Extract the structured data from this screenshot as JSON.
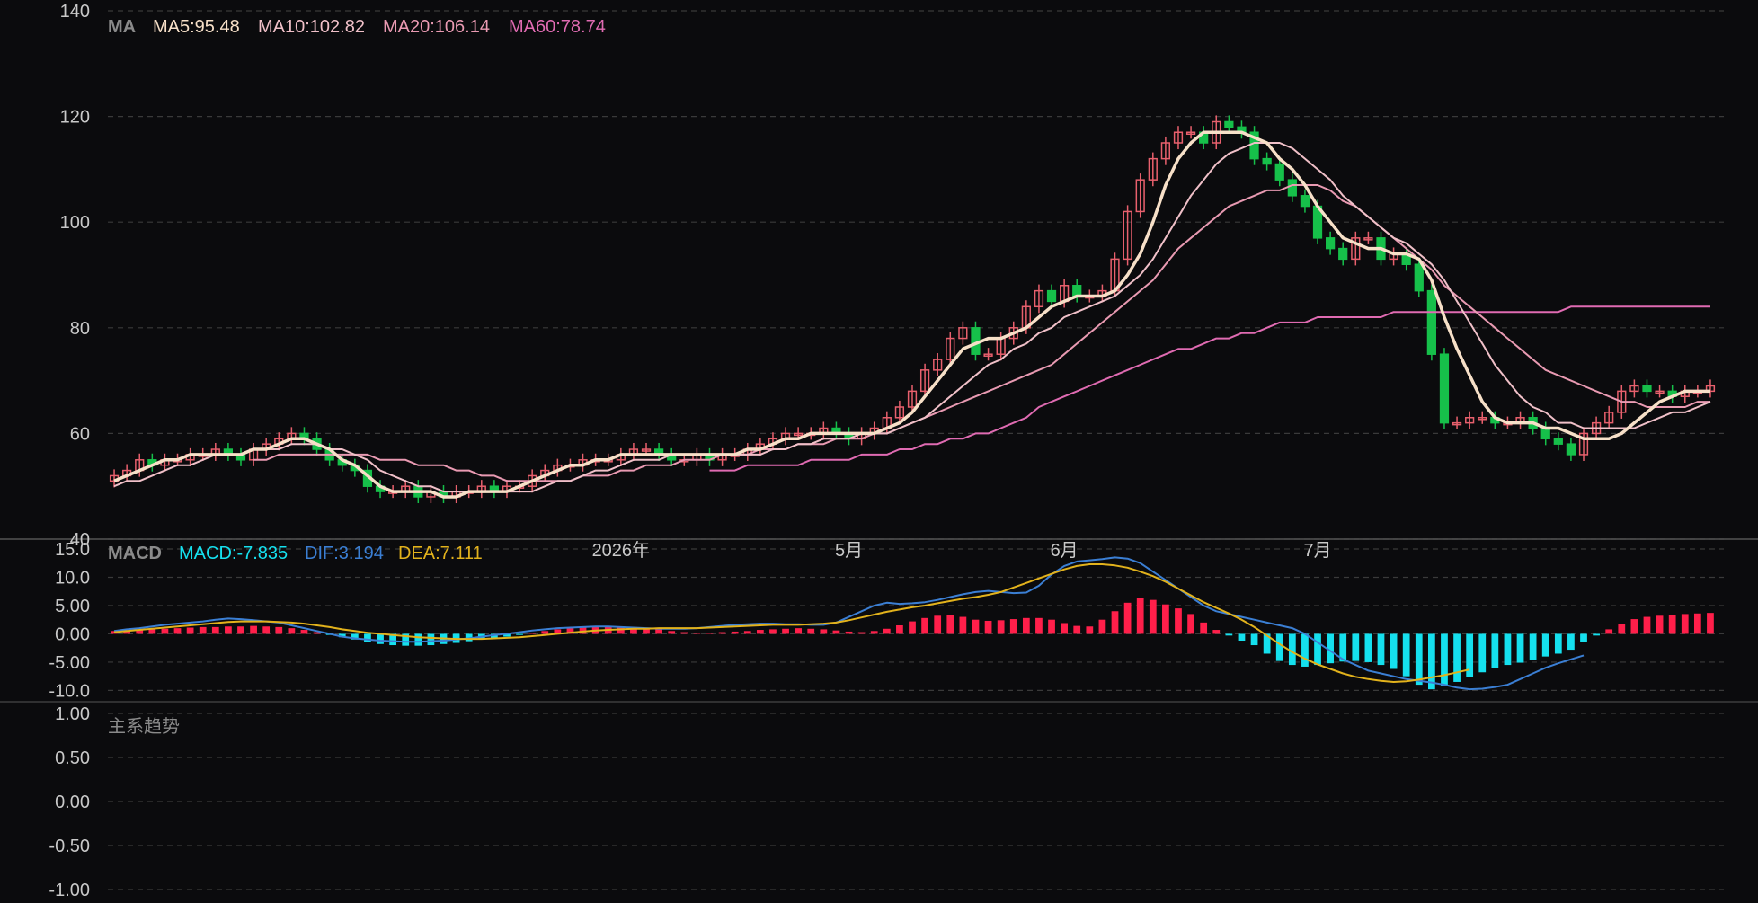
{
  "colors": {
    "background": "#0b0b0d",
    "grid": "#3a3a3a",
    "axis_text": "#c9c9c9",
    "up": "#ff3b50",
    "up_outline": "#e8606d",
    "down": "#16c04a",
    "ma5": "#f7e0c8",
    "ma10": "#f0c0c8",
    "ma20": "#e99ab2",
    "ma60": "#e06bb2",
    "macd_pos": "#ff1f4a",
    "macd_neg": "#15e0ee",
    "dif": "#3b7fd4",
    "dea": "#e2b21c"
  },
  "legends": {
    "main": {
      "title": "MA",
      "ma5": "MA5:95.48",
      "ma10": "MA10:102.82",
      "ma20": "MA20:106.14",
      "ma60": "MA60:78.74"
    },
    "macd": {
      "title": "MACD",
      "macd": "MACD:-7.835",
      "dif": "DIF:3.194",
      "dea": "DEA:7.111"
    },
    "trend": {
      "title": "主系趋势"
    }
  },
  "chart_data": [
    {
      "type": "candlestick",
      "panel": "price",
      "ylim": [
        40,
        140
      ],
      "yticks": [
        "140",
        "120",
        "100",
        "80",
        "60",
        "40"
      ],
      "xticks": [
        {
          "label": "2026年",
          "index": 40
        },
        {
          "label": "5月",
          "index": 58
        },
        {
          "label": "6月",
          "index": 75
        },
        {
          "label": "7月",
          "index": 95
        }
      ],
      "series_names": [
        "MA5",
        "MA10",
        "MA20",
        "MA60"
      ],
      "close": [
        52,
        53,
        55,
        54,
        55,
        55,
        56,
        56,
        57,
        56,
        55,
        57,
        58,
        59,
        60,
        59,
        57,
        55,
        54,
        53,
        50,
        49,
        49,
        50,
        48,
        49,
        48,
        49,
        49,
        50,
        49,
        50,
        50,
        52,
        53,
        54,
        54,
        55,
        55,
        55,
        56,
        57,
        57,
        56,
        55,
        55,
        56,
        55,
        56,
        56,
        57,
        58,
        59,
        60,
        60,
        60,
        61,
        60,
        59,
        60,
        61,
        63,
        65,
        68,
        72,
        74,
        78,
        80,
        75,
        75,
        78,
        80,
        84,
        87,
        85,
        88,
        86,
        86,
        87,
        93,
        102,
        108,
        112,
        115,
        117,
        117,
        115,
        119,
        118,
        117,
        112,
        111,
        108,
        105,
        103,
        97,
        95,
        93,
        97,
        97,
        93,
        94,
        92,
        87,
        75,
        62,
        62,
        63,
        63,
        62,
        62,
        63,
        61,
        59,
        58,
        56,
        60,
        62,
        64,
        68,
        69,
        68,
        68,
        67,
        68,
        68,
        69
      ],
      "ma5": [
        51,
        52,
        53,
        54,
        55,
        55,
        56,
        56,
        56,
        56,
        56,
        57,
        57,
        58,
        59,
        59,
        58,
        57,
        55,
        54,
        52,
        50,
        49,
        49,
        49,
        49,
        48,
        48,
        49,
        49,
        49,
        49,
        50,
        51,
        52,
        53,
        54,
        54,
        55,
        55,
        56,
        56,
        56,
        56,
        56,
        56,
        56,
        56,
        56,
        56,
        57,
        57,
        58,
        59,
        59,
        60,
        60,
        60,
        60,
        60,
        60,
        61,
        62,
        64,
        67,
        70,
        73,
        76,
        77,
        78,
        78,
        79,
        80,
        82,
        84,
        85,
        86,
        86,
        86,
        87,
        90,
        94,
        100,
        107,
        112,
        115,
        117,
        117,
        117,
        117,
        116,
        115,
        112,
        110,
        107,
        103,
        100,
        97,
        96,
        95,
        95,
        94,
        94,
        93,
        89,
        82,
        76,
        71,
        66,
        63,
        62,
        62,
        62,
        61,
        61,
        60,
        59,
        59,
        59,
        60,
        62,
        64,
        66,
        67,
        68,
        68,
        68
      ],
      "ma10": [
        50,
        51,
        51,
        52,
        53,
        54,
        54,
        55,
        56,
        56,
        56,
        57,
        57,
        57,
        58,
        58,
        58,
        57,
        57,
        56,
        55,
        53,
        52,
        51,
        50,
        50,
        49,
        49,
        49,
        49,
        49,
        49,
        49,
        49,
        50,
        51,
        51,
        52,
        53,
        53,
        54,
        55,
        55,
        55,
        56,
        56,
        56,
        56,
        56,
        56,
        56,
        56,
        57,
        57,
        58,
        58,
        59,
        59,
        59,
        60,
        60,
        60,
        61,
        62,
        63,
        65,
        67,
        69,
        71,
        73,
        74,
        76,
        77,
        79,
        80,
        82,
        83,
        84,
        85,
        86,
        88,
        90,
        93,
        97,
        101,
        105,
        108,
        111,
        113,
        114,
        115,
        115,
        115,
        114,
        112,
        110,
        108,
        105,
        103,
        101,
        99,
        97,
        96,
        94,
        92,
        89,
        85,
        81,
        77,
        73,
        70,
        67,
        65,
        64,
        62,
        62,
        61,
        61,
        61,
        61,
        61,
        62,
        63,
        64,
        64,
        65,
        66
      ],
      "ma20": [
        null,
        null,
        null,
        null,
        null,
        null,
        null,
        null,
        null,
        null,
        null,
        55,
        55,
        56,
        56,
        56,
        56,
        56,
        56,
        56,
        56,
        55,
        55,
        55,
        54,
        54,
        54,
        53,
        53,
        52,
        52,
        51,
        51,
        51,
        51,
        51,
        51,
        52,
        52,
        52,
        53,
        53,
        54,
        54,
        54,
        55,
        55,
        55,
        56,
        56,
        56,
        57,
        57,
        57,
        58,
        58,
        58,
        59,
        59,
        59,
        60,
        60,
        61,
        62,
        63,
        64,
        65,
        66,
        67,
        68,
        69,
        70,
        71,
        72,
        73,
        75,
        77,
        79,
        81,
        83,
        85,
        87,
        89,
        92,
        95,
        97,
        99,
        101,
        103,
        104,
        105,
        106,
        106,
        107,
        107,
        107,
        106,
        104,
        103,
        101,
        99,
        97,
        95,
        93,
        91,
        88,
        86,
        84,
        82,
        80,
        78,
        76,
        74,
        72,
        71,
        70,
        69,
        68,
        67,
        66,
        66,
        65,
        65,
        65,
        65,
        66,
        66
      ],
      "ma60": [
        null,
        null,
        null,
        null,
        null,
        null,
        null,
        null,
        null,
        null,
        null,
        null,
        null,
        null,
        null,
        null,
        null,
        null,
        null,
        null,
        null,
        null,
        null,
        null,
        null,
        null,
        null,
        null,
        null,
        null,
        null,
        null,
        null,
        null,
        null,
        null,
        null,
        null,
        null,
        null,
        null,
        null,
        null,
        null,
        null,
        null,
        null,
        53,
        53,
        53,
        54,
        54,
        54,
        54,
        54,
        55,
        55,
        55,
        55,
        56,
        56,
        56,
        57,
        57,
        58,
        58,
        59,
        59,
        60,
        60,
        61,
        62,
        63,
        65,
        66,
        67,
        68,
        69,
        70,
        71,
        72,
        73,
        74,
        75,
        76,
        76,
        77,
        78,
        78,
        79,
        79,
        80,
        81,
        81,
        81,
        82,
        82,
        82,
        82,
        82,
        82,
        83,
        83,
        83,
        83,
        83,
        83,
        83,
        83,
        83,
        83,
        83,
        83,
        83,
        83,
        84,
        84,
        84,
        84,
        84,
        84,
        84,
        84,
        84,
        84,
        84,
        84
      ]
    },
    {
      "type": "bar",
      "panel": "macd",
      "ylim": [
        -12,
        15
      ],
      "yticks": [
        "15.0",
        "10.0",
        "5.00",
        "0.00",
        "-5.00",
        "-10.0"
      ],
      "series_names": [
        "MACD",
        "DIF",
        "DEA"
      ],
      "macd": [
        0.5,
        0.6,
        0.7,
        0.8,
        0.9,
        1.0,
        1.1,
        1.2,
        1.2,
        1.3,
        1.3,
        1.4,
        1.3,
        1.2,
        1.0,
        0.7,
        0.3,
        -0.2,
        -0.6,
        -1.0,
        -1.5,
        -1.8,
        -2.0,
        -2.1,
        -2.1,
        -2.0,
        -1.8,
        -1.6,
        -1.3,
        -1.0,
        -0.8,
        -0.5,
        -0.2,
        0.2,
        0.5,
        0.8,
        1.0,
        1.2,
        1.2,
        1.3,
        1.3,
        1.2,
        1.0,
        0.8,
        0.5,
        0.3,
        0.2,
        0.2,
        0.3,
        0.4,
        0.5,
        0.7,
        0.8,
        0.9,
        1.0,
        0.9,
        0.8,
        0.6,
        0.4,
        0.3,
        0.5,
        0.9,
        1.5,
        2.2,
        2.8,
        3.2,
        3.4,
        3.0,
        2.5,
        2.3,
        2.4,
        2.6,
        2.8,
        2.8,
        2.5,
        1.9,
        1.4,
        1.3,
        2.5,
        4.0,
        5.5,
        6.3,
        6.0,
        5.2,
        4.5,
        3.5,
        2.0,
        0.7,
        -0.3,
        -1.2,
        -2.0,
        -3.5,
        -4.8,
        -5.5,
        -5.8,
        -5.5,
        -5.2,
        -4.9,
        -4.8,
        -5.0,
        -5.5,
        -6.2,
        -7.5,
        -9.0,
        -9.8,
        -9.3,
        -8.5,
        -7.6,
        -6.8,
        -6.0,
        -5.5,
        -5.1,
        -4.6,
        -4.0,
        -3.5,
        -2.8,
        -1.5,
        -0.3,
        0.8,
        1.8,
        2.6,
        3.0,
        3.2,
        3.4,
        3.5,
        3.6,
        3.7
      ],
      "dif": [
        0.5,
        0.8,
        1.0,
        1.3,
        1.6,
        1.8,
        2.0,
        2.2,
        2.5,
        2.7,
        2.6,
        2.4,
        2.2,
        2.0,
        1.5,
        1.0,
        0.5,
        0.0,
        -0.5,
        -0.8,
        -1.0,
        -1.2,
        -1.3,
        -1.4,
        -1.4,
        -1.3,
        -1.2,
        -1.0,
        -0.8,
        -0.5,
        -0.2,
        0.0,
        0.3,
        0.6,
        0.8,
        1.0,
        1.1,
        1.2,
        1.3,
        1.3,
        1.2,
        1.1,
        1.0,
        0.9,
        0.9,
        0.9,
        1.0,
        1.2,
        1.4,
        1.6,
        1.7,
        1.8,
        1.8,
        1.7,
        1.7,
        1.6,
        1.6,
        2.0,
        3.0,
        4.0,
        5.0,
        5.5,
        5.3,
        5.4,
        5.6,
        6.0,
        6.5,
        7.0,
        7.4,
        7.6,
        7.4,
        7.2,
        7.3,
        8.5,
        10.5,
        12.0,
        12.8,
        13.0,
        13.2,
        13.5,
        13.3,
        12.5,
        11.0,
        9.5,
        8.0,
        6.5,
        5.0,
        4.0,
        3.5,
        3.0,
        2.5,
        2.0,
        1.5,
        1.0,
        0.0,
        -1.5,
        -3.0,
        -4.5,
        -5.5,
        -6.5,
        -7.0,
        -7.5,
        -8.0,
        -8.3,
        -8.6,
        -9.0,
        -9.5,
        -9.8,
        -9.7,
        -9.4,
        -9.0,
        -8.0,
        -7.0,
        -6.0,
        -5.2,
        -4.5,
        -3.8
      ],
      "dea": [
        0.3,
        0.5,
        0.7,
        0.9,
        1.1,
        1.3,
        1.5,
        1.7,
        1.9,
        2.1,
        2.2,
        2.2,
        2.2,
        2.1,
        2.0,
        1.8,
        1.5,
        1.2,
        0.8,
        0.5,
        0.2,
        0.0,
        -0.2,
        -0.4,
        -0.6,
        -0.7,
        -0.8,
        -0.9,
        -0.9,
        -0.9,
        -0.8,
        -0.7,
        -0.6,
        -0.4,
        -0.2,
        0.0,
        0.2,
        0.4,
        0.6,
        0.7,
        0.8,
        0.9,
        0.9,
        1.0,
        1.0,
        1.0,
        1.0,
        1.1,
        1.2,
        1.3,
        1.4,
        1.5,
        1.6,
        1.6,
        1.6,
        1.7,
        1.8,
        2.0,
        2.4,
        2.9,
        3.4,
        3.9,
        4.3,
        4.7,
        5.0,
        5.4,
        5.8,
        6.2,
        6.5,
        6.9,
        7.4,
        8.2,
        9.0,
        9.8,
        10.6,
        11.4,
        12.0,
        12.3,
        12.3,
        12.1,
        11.7,
        11.0,
        10.2,
        9.2,
        8.0,
        6.8,
        5.6,
        4.6,
        3.6,
        2.5,
        1.2,
        -0.3,
        -1.8,
        -3.2,
        -4.4,
        -5.4,
        -6.2,
        -7.0,
        -7.6,
        -8.0,
        -8.3,
        -8.5,
        -8.4,
        -8.1,
        -7.7,
        -7.3,
        -6.8,
        -6.3
      ]
    },
    {
      "type": "line",
      "panel": "trend",
      "ylim": [
        -1,
        1
      ],
      "yticks": [
        "1.00",
        "0.50",
        "0.00",
        "-0.50",
        "-1.00"
      ],
      "values": []
    }
  ]
}
